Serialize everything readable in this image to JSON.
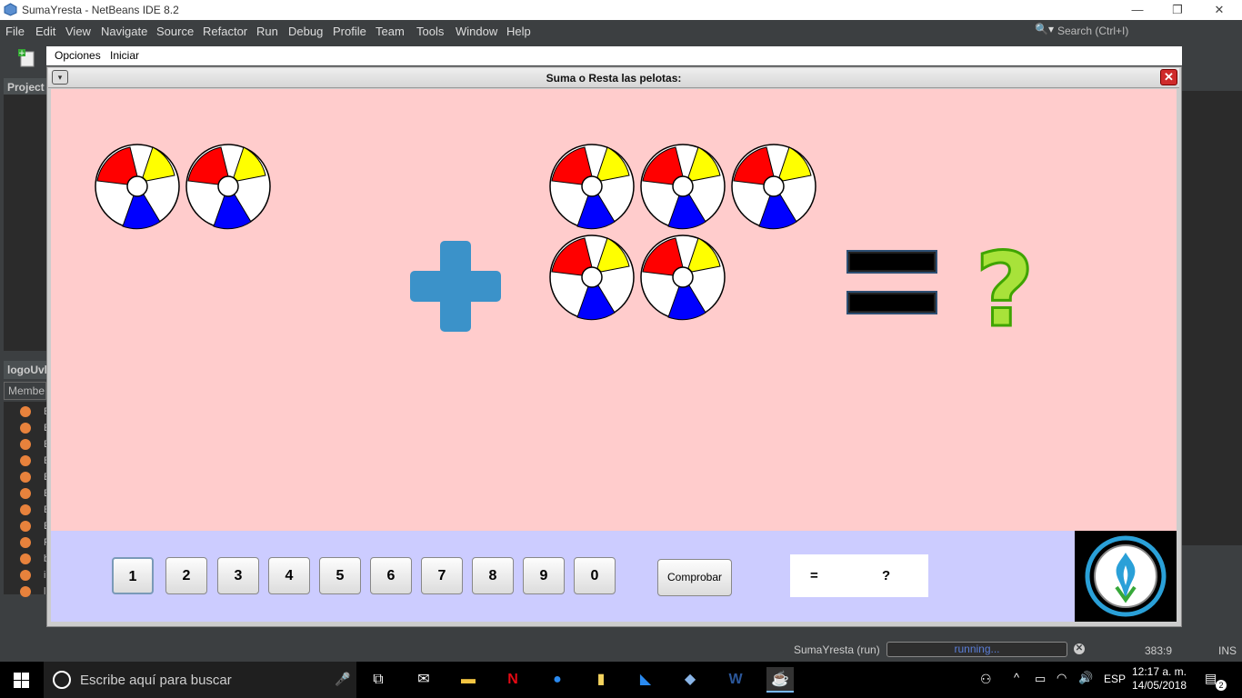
{
  "ide": {
    "window_title": "SumaYresta - NetBeans IDE 8.2",
    "window_buttons": {
      "minimize": "—",
      "maximize": "❐",
      "close": "✕"
    },
    "menu": [
      "File",
      "Edit",
      "View",
      "Navigate",
      "Source",
      "Refactor",
      "Run",
      "Debug",
      "Profile",
      "Team",
      "Tools",
      "Window",
      "Help"
    ],
    "search_placeholder": "Search (Ctrl+I)",
    "projects_tab": "Project",
    "navigator_tab": "logoUvl",
    "navigator_combo": "Membe",
    "navigator_rows": [
      "E",
      "E",
      "E",
      "E",
      "E",
      "E",
      "E",
      "E",
      "F",
      "b",
      "ir",
      "lo"
    ],
    "status": {
      "project": "SumaYresta (run)",
      "progress_text": "running...",
      "cursor_position": "383:9",
      "insert_mode": "INS"
    }
  },
  "app": {
    "menu": [
      "Opciones",
      "Iniciar"
    ],
    "frame_title": "Suma o Resta las pelotas:",
    "frame_menu_icon": "▾",
    "frame_close_icon": "✕",
    "operator": "plus",
    "left_balls": 2,
    "right_balls": 5,
    "question_mark": "?",
    "number_buttons": [
      "1",
      "2",
      "3",
      "4",
      "5",
      "6",
      "7",
      "8",
      "9",
      "0"
    ],
    "selected_number": "1",
    "check_button": "Comprobar",
    "result": {
      "equals": "=",
      "value": "?"
    },
    "colors": {
      "content_bg": "#ffcccc",
      "bottom_bg": "#ccccff",
      "plus": "#3b92c9",
      "qmark": "#a8e23a"
    }
  },
  "taskbar": {
    "search_placeholder": "Escribe aquí para buscar",
    "apps": [
      "task-view",
      "mail",
      "file-explorer",
      "netflix",
      "firefox",
      "files",
      "vscode",
      "virtualbox",
      "word",
      "java"
    ],
    "language": "ESP",
    "time": "12:17 a. m.",
    "date": "14/05/2018",
    "notification_count": "2"
  }
}
